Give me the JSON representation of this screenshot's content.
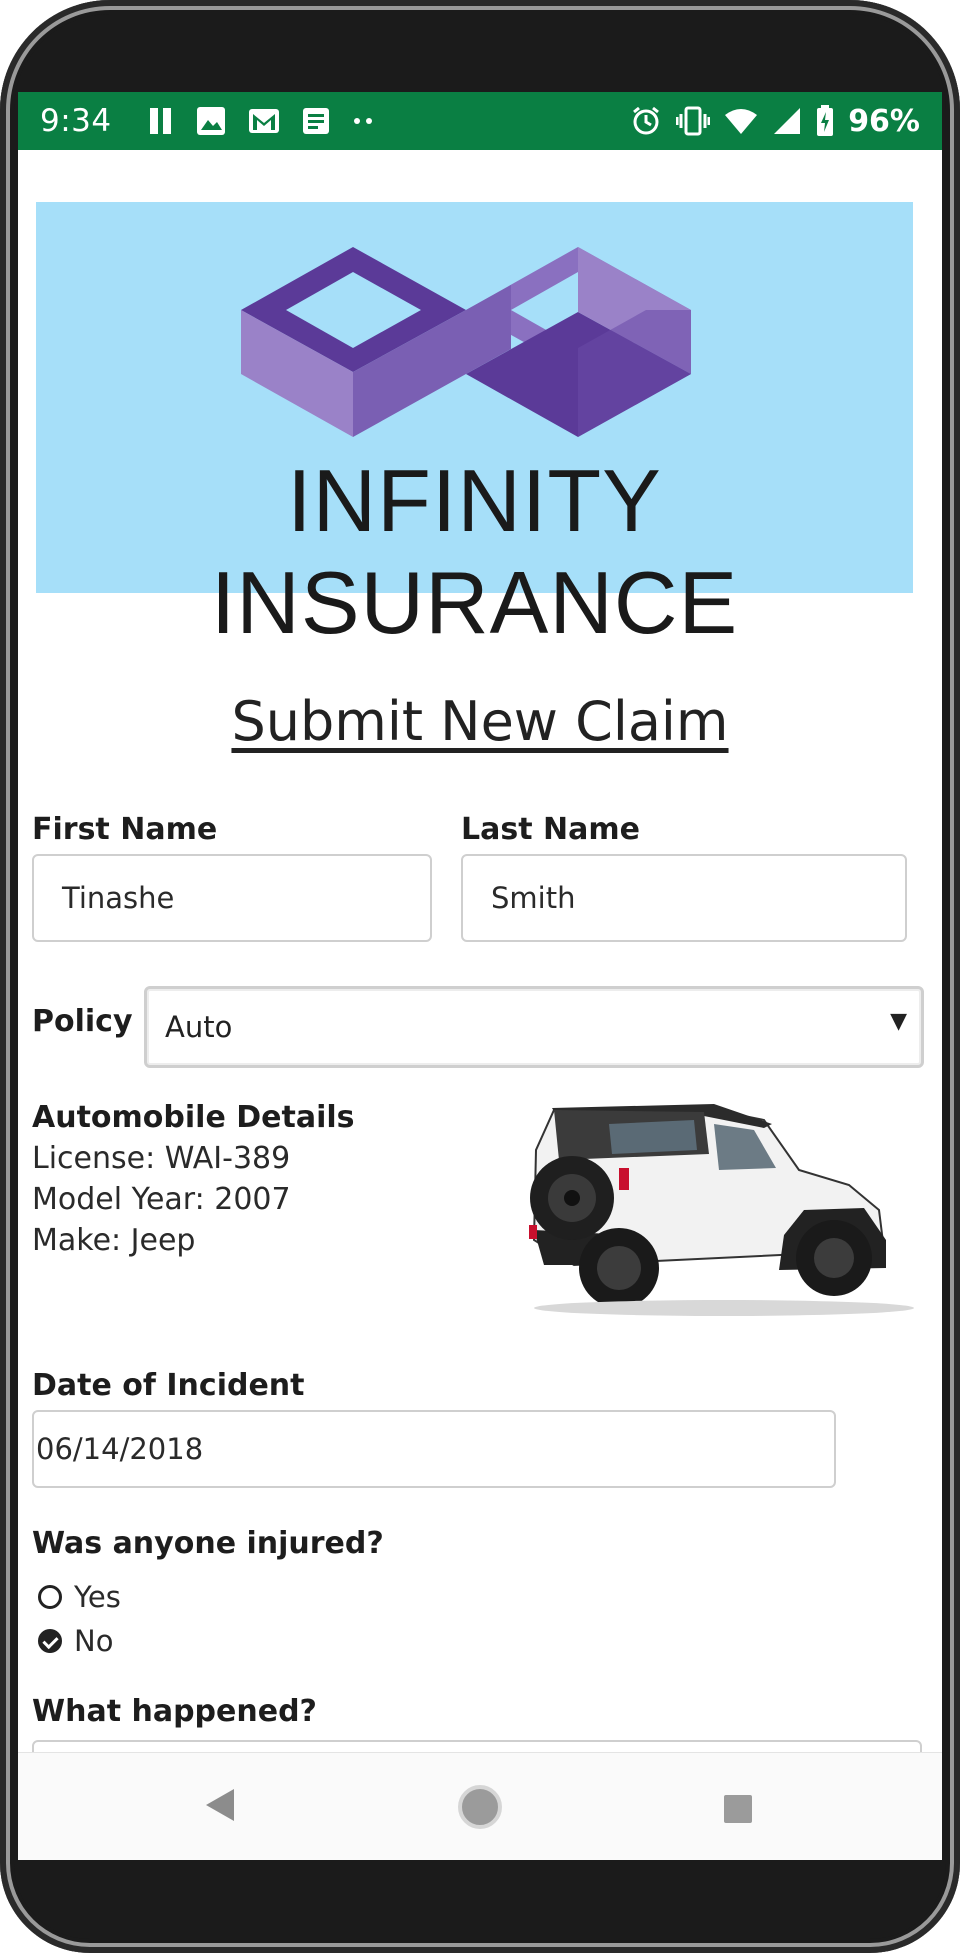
{
  "status_bar": {
    "time": "9:34",
    "left_icons": [
      "pause-icon",
      "image-icon",
      "gmail-icon",
      "document-icon",
      "more-dots-icon"
    ],
    "right_icons": [
      "alarm-icon",
      "vibrate-icon",
      "wifi-icon",
      "signal-icon",
      "battery-charging-icon"
    ],
    "battery": "96%",
    "background": "#0a7f43"
  },
  "banner": {
    "brand_name": "INFINITY INSURANCE",
    "background": "#a6dff9",
    "logo_colors": [
      "#5b3a98",
      "#9a82c8",
      "#7a5fb3"
    ]
  },
  "form": {
    "title": "Submit New Claim",
    "first_name": {
      "label": "First Name",
      "value": "Tinashe"
    },
    "last_name": {
      "label": "Last Name",
      "value": "Smith"
    },
    "policy": {
      "label": "Policy",
      "selected": "Auto"
    },
    "automobile": {
      "heading": "Automobile Details",
      "license": "License: WAI-389",
      "model_year": "Model Year: 2007",
      "make": "Make: Jeep",
      "image": "jeep-wrangler-image"
    },
    "date": {
      "label": "Date of Incident",
      "value": "06/14/2018"
    },
    "injured": {
      "question": "Was anyone injured?",
      "options": [
        {
          "label": "Yes",
          "checked": false
        },
        {
          "label": "No",
          "checked": true
        }
      ]
    },
    "what_happened": {
      "label": "What happened?"
    }
  },
  "nav_bar": {
    "buttons": [
      "back-icon",
      "home-icon",
      "recents-icon"
    ]
  }
}
